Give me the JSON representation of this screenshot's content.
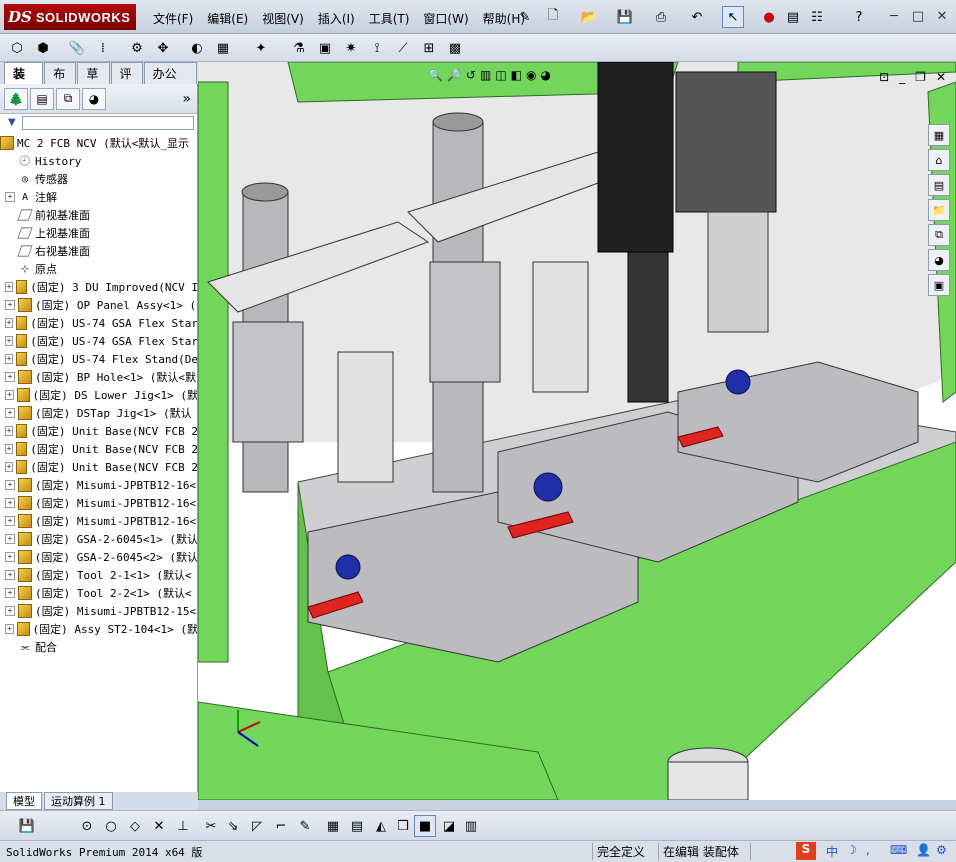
{
  "app": {
    "logo_ds": "DS",
    "logo_name": "SOLIDWORKS"
  },
  "menu": [
    "文件(F)",
    "编辑(E)",
    "视图(V)",
    "插入(I)",
    "工具(T)",
    "窗口(W)",
    "帮助(H)"
  ],
  "tabs": [
    "装配体",
    "布局",
    "草图",
    "评估",
    "办公室产品"
  ],
  "tree": {
    "root": "MC 2 FCB NCV  (默认<默认_显示",
    "items": [
      {
        "label": "History",
        "icon": "history-icon",
        "expandable": false
      },
      {
        "label": "传感器",
        "icon": "sensor-icon",
        "expandable": false
      },
      {
        "label": "注解",
        "icon": "annotation-icon",
        "expandable": true
      },
      {
        "label": "前视基准面",
        "icon": "plane-icon",
        "expandable": false
      },
      {
        "label": "上视基准面",
        "icon": "plane-icon",
        "expandable": false
      },
      {
        "label": "右视基准面",
        "icon": "plane-icon",
        "expandable": false
      },
      {
        "label": "原点",
        "icon": "origin-icon",
        "expandable": false
      },
      {
        "label": "(固定) 3 DU Improved(NCV I",
        "icon": "assembly-icon",
        "expandable": true
      },
      {
        "label": "(固定) OP Panel Assy<1> (",
        "icon": "assembly-icon",
        "expandable": true
      },
      {
        "label": "(固定) US-74 GSA Flex Star",
        "icon": "assembly-icon",
        "expandable": true
      },
      {
        "label": "(固定) US-74 GSA Flex Star",
        "icon": "assembly-icon",
        "expandable": true
      },
      {
        "label": "(固定) US-74 Flex Stand(De",
        "icon": "assembly-icon",
        "expandable": true
      },
      {
        "label": "(固定) BP Hole<1> (默认<默",
        "icon": "assembly-icon",
        "expandable": true
      },
      {
        "label": "(固定) DS Lower Jig<1> (默",
        "icon": "assembly-icon",
        "expandable": true
      },
      {
        "label": "(固定) DSTap Jig<1> (默认",
        "icon": "assembly-icon",
        "expandable": true
      },
      {
        "label": "(固定) Unit Base(NCV FCB 2",
        "icon": "part-icon",
        "expandable": true
      },
      {
        "label": "(固定) Unit Base(NCV FCB 2",
        "icon": "part-icon",
        "expandable": true
      },
      {
        "label": "(固定) Unit Base(NCV FCB 2",
        "icon": "part-icon",
        "expandable": true
      },
      {
        "label": "(固定) Misumi-JPBTB12-16<",
        "icon": "part-icon",
        "expandable": true
      },
      {
        "label": "(固定) Misumi-JPBTB12-16<",
        "icon": "part-icon",
        "expandable": true
      },
      {
        "label": "(固定) Misumi-JPBTB12-16<",
        "icon": "part-icon",
        "expandable": true
      },
      {
        "label": "(固定) GSA-2-6045<1> (默认",
        "icon": "part-icon",
        "expandable": true
      },
      {
        "label": "(固定) GSA-2-6045<2> (默认",
        "icon": "part-icon",
        "expandable": true
      },
      {
        "label": "(固定) Tool 2-1<1> (默认<",
        "icon": "part-icon",
        "expandable": true
      },
      {
        "label": "(固定) Tool 2-2<1> (默认<",
        "icon": "part-icon",
        "expandable": true
      },
      {
        "label": "(固定) Misumi-JPBTB12-15<",
        "icon": "part-icon",
        "expandable": true
      },
      {
        "label": "(固定) Assy ST2-104<1> (默",
        "icon": "part-icon",
        "expandable": true
      },
      {
        "label": "配合",
        "icon": "mates-icon",
        "expandable": false
      }
    ]
  },
  "bottom_tabs": [
    "模型",
    "运动算例 1"
  ],
  "status": {
    "version": "SolidWorks Premium 2014 x64 版",
    "definition": "完全定义",
    "mode": "在编辑 装配体"
  },
  "ime": {
    "lang": "中"
  },
  "colors": {
    "frame_green": "#72d65a",
    "title_red": "#a00000",
    "viewport_bg": "#ffffff"
  }
}
